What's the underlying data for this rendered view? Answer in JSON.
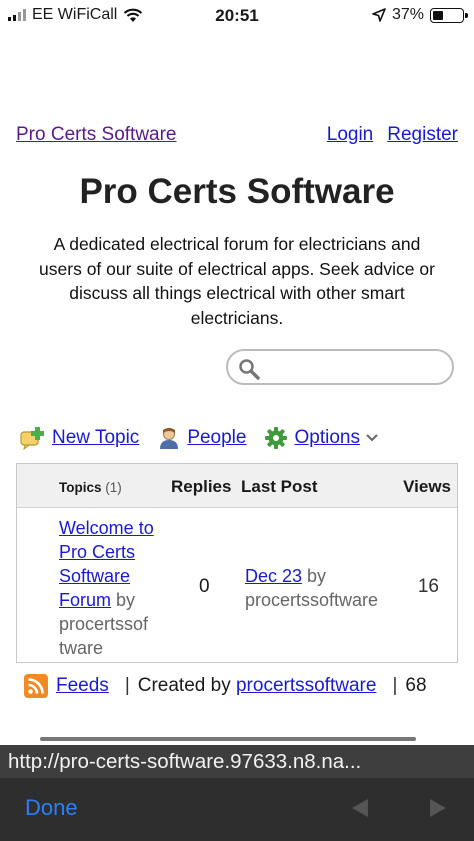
{
  "status_bar": {
    "carrier": "EE WiFiCall",
    "time": "20:51",
    "battery_percent": "37%",
    "battery_level": 0.37
  },
  "header": {
    "home_link": "Pro Certs Software",
    "login_link": "Login",
    "register_link": "Register"
  },
  "title": "Pro Certs Software",
  "description": "A dedicated electrical forum for electricians and users of our suite of electrical apps. Seek advice or discuss all things electrical with other smart electricians.",
  "search": {
    "placeholder": ""
  },
  "toolbar": {
    "new_topic": "New Topic",
    "people": "People",
    "options": "Options"
  },
  "table": {
    "headers": {
      "topics": "Topics",
      "topics_count": "(1)",
      "replies": "Replies",
      "last_post": "Last Post",
      "views": "Views"
    },
    "rows": [
      {
        "topic_line1": "Welcome to",
        "topic_line2": "Pro Certs",
        "topic_line3": "Software",
        "topic_line4": "Forum",
        "by_word": " by",
        "author_line1": "procertssof",
        "author_line2": "tware",
        "replies": "0",
        "last_post_date": "Dec 23",
        "last_post_by": " by",
        "last_post_author": "procertssoftware",
        "views": "16"
      }
    ]
  },
  "footer": {
    "feeds": "Feeds",
    "separator": "|",
    "created_by": "Created by ",
    "creator": "procertssoftware",
    "separator2": "|",
    "trailing": "68"
  },
  "browser": {
    "url": "http://pro-certs-software.97633.n8.na...",
    "done": "Done"
  },
  "colors": {
    "link": "#1a1ad6",
    "visited_link": "#5a1a8a",
    "done_button": "#2d7ff5",
    "rss": "#f08a24"
  }
}
